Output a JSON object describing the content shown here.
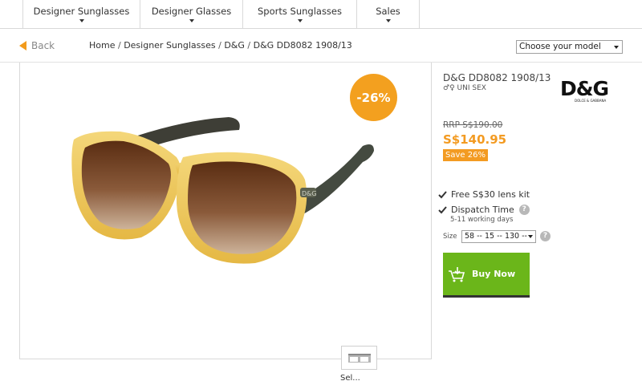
{
  "nav": {
    "items": [
      {
        "label": "Designer Sunglasses"
      },
      {
        "label": "Designer Glasses"
      },
      {
        "label": "Sports Sunglasses"
      },
      {
        "label": "Sales"
      }
    ]
  },
  "breadcrumb": {
    "back_label": "Back",
    "items": [
      "Home",
      "Designer Sunglasses",
      "D&G",
      "D&G DD8082 1908/13"
    ],
    "separator": "/"
  },
  "model_select": {
    "selected": "Choose your model"
  },
  "product": {
    "discount_badge": "-26%",
    "title": "D&G DD8082 1908/13",
    "gender_icon": "male-female-icon",
    "gender_label": "UNI SEX",
    "brand_logo_text": "D&G",
    "brand_logo_subtext": "DOLCE & GABBANA",
    "rrp": "RRP S$190.00",
    "price": "S$140.95",
    "save": "Save 26%",
    "features": [
      {
        "label": "Free S$30 lens kit"
      },
      {
        "label": "Dispatch Time",
        "sub": "5-11 working days"
      }
    ],
    "size_label": "Size",
    "size_selected": "58 -- 15 -- 130 --",
    "buy_label": "Buy Now",
    "thumb_label": "Sel..."
  },
  "colors": {
    "accent": "#f39b22",
    "buy_button": "#6bb61a",
    "help_icon": "#b8b8b8"
  }
}
